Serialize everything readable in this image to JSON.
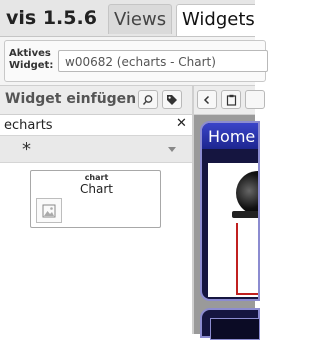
{
  "app": {
    "title": "vis 1.5.6"
  },
  "tabs": [
    {
      "label": "Views"
    },
    {
      "label": "Widgets"
    }
  ],
  "active_widget": {
    "label": "Aktives Widget:",
    "value": "w00682 (echarts - Chart)"
  },
  "widget_panel": {
    "title": "Widget einfügen",
    "filter_value": "echarts",
    "widget_set": "*",
    "widgets": [
      {
        "set": "chart",
        "name": "Chart"
      }
    ]
  },
  "canvas": {
    "view_label": "Home"
  },
  "icons": {
    "search": "search-icon",
    "tag": "tag-icon",
    "clear": "close-icon",
    "dropdown": "chevron-down-icon",
    "prev": "chevron-left-icon",
    "clipboard": "clipboard-icon",
    "image": "image-icon"
  },
  "colors": {
    "view_background": "#151540",
    "view_header": "#2a35b0",
    "wire": "#c02020"
  }
}
